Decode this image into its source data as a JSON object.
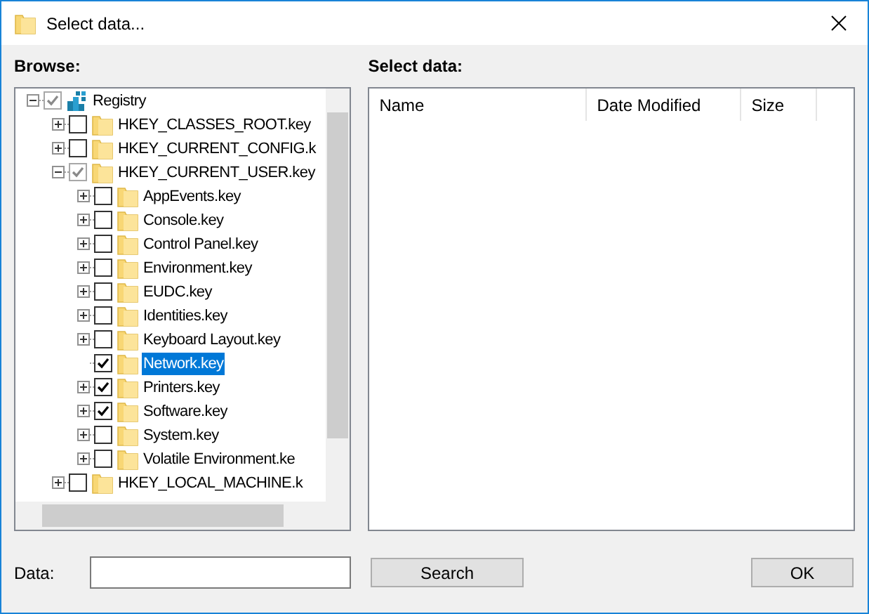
{
  "window": {
    "title": "Select data..."
  },
  "browse": {
    "label": "Browse:",
    "tree": [
      {
        "label": "Registry",
        "kind": "branch",
        "expanded": true,
        "checked": true,
        "dimmed": true,
        "selected": false,
        "children": [
          {
            "label": "HKEY_CLASSES_ROOT.key",
            "kind": "branch",
            "expanded": false,
            "checked": false,
            "dimmed": false,
            "selected": false
          },
          {
            "label": "HKEY_CURRENT_CONFIG.k",
            "kind": "branch",
            "expanded": false,
            "checked": false,
            "dimmed": false,
            "selected": false
          },
          {
            "label": "HKEY_CURRENT_USER.key",
            "kind": "branch",
            "expanded": true,
            "checked": true,
            "dimmed": true,
            "selected": false,
            "children": [
              {
                "label": "AppEvents.key",
                "kind": "branch",
                "expanded": false,
                "checked": false,
                "dimmed": false,
                "selected": false
              },
              {
                "label": "Console.key",
                "kind": "branch",
                "expanded": false,
                "checked": false,
                "dimmed": false,
                "selected": false
              },
              {
                "label": "Control Panel.key",
                "kind": "branch",
                "expanded": false,
                "checked": false,
                "dimmed": false,
                "selected": false
              },
              {
                "label": "Environment.key",
                "kind": "branch",
                "expanded": false,
                "checked": false,
                "dimmed": false,
                "selected": false
              },
              {
                "label": "EUDC.key",
                "kind": "branch",
                "expanded": false,
                "checked": false,
                "dimmed": false,
                "selected": false
              },
              {
                "label": "Identities.key",
                "kind": "branch",
                "expanded": false,
                "checked": false,
                "dimmed": false,
                "selected": false
              },
              {
                "label": "Keyboard Layout.key",
                "kind": "branch",
                "expanded": false,
                "checked": false,
                "dimmed": false,
                "selected": false
              },
              {
                "label": "Network.key",
                "kind": "leaf",
                "checked": true,
                "dimmed": false,
                "selected": true
              },
              {
                "label": "Printers.key",
                "kind": "branch",
                "expanded": false,
                "checked": true,
                "dimmed": false,
                "selected": false
              },
              {
                "label": "Software.key",
                "kind": "branch",
                "expanded": false,
                "checked": true,
                "dimmed": false,
                "selected": false
              },
              {
                "label": "System.key",
                "kind": "branch",
                "expanded": false,
                "checked": false,
                "dimmed": false,
                "selected": false
              },
              {
                "label": "Volatile Environment.ke",
                "kind": "branch",
                "expanded": false,
                "checked": false,
                "dimmed": false,
                "selected": false
              }
            ]
          },
          {
            "label": "HKEY_LOCAL_MACHINE.k",
            "kind": "branch",
            "expanded": false,
            "checked": false,
            "dimmed": false,
            "selected": false
          }
        ]
      }
    ]
  },
  "select_data": {
    "label": "Select data:",
    "columns": [
      "Name",
      "Date Modified",
      "Size"
    ]
  },
  "data_field": {
    "label": "Data:"
  },
  "buttons": [
    "Search",
    "OK"
  ]
}
